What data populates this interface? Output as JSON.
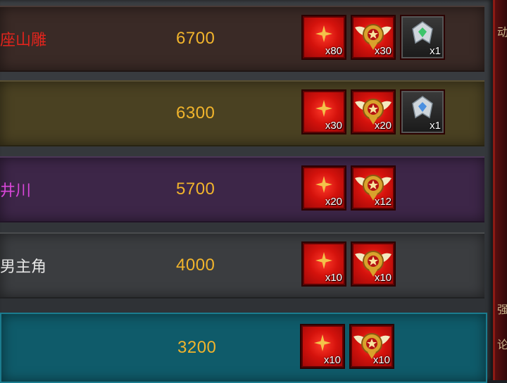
{
  "side_panel": {
    "chars": [
      "动",
      "强",
      "论"
    ]
  },
  "rows": [
    {
      "name": "座山雕",
      "score": "6700",
      "name_color": "#e0241d",
      "bg": "#3a2a26",
      "rewards": [
        {
          "type": "star",
          "qty": "x80"
        },
        {
          "type": "medal",
          "qty": "x30"
        },
        {
          "type": "emblem-green",
          "qty": "x1"
        }
      ]
    },
    {
      "name": "",
      "score": "6300",
      "name_color": "#ffffff",
      "bg": "#4a4122",
      "rewards": [
        {
          "type": "star",
          "qty": "x30"
        },
        {
          "type": "medal",
          "qty": "x20"
        },
        {
          "type": "emblem-blue",
          "qty": "x1"
        }
      ]
    },
    {
      "name": "井川",
      "score": "5700",
      "name_color": "#d846d8",
      "bg": "#3d2648",
      "rewards": [
        {
          "type": "star",
          "qty": "x20"
        },
        {
          "type": "medal",
          "qty": "x12"
        }
      ]
    },
    {
      "name": "男主角",
      "score": "4000",
      "name_color": "#e6e6e6",
      "bg": "#3b3d40",
      "rewards": [
        {
          "type": "star",
          "qty": "x10"
        },
        {
          "type": "medal",
          "qty": "x10"
        }
      ]
    },
    {
      "name": "",
      "score": "3200",
      "name_color": "#ffffff",
      "bg": "#0f5b6a",
      "rewards": [
        {
          "type": "star",
          "qty": "x10"
        },
        {
          "type": "medal",
          "qty": "x10"
        }
      ]
    }
  ]
}
